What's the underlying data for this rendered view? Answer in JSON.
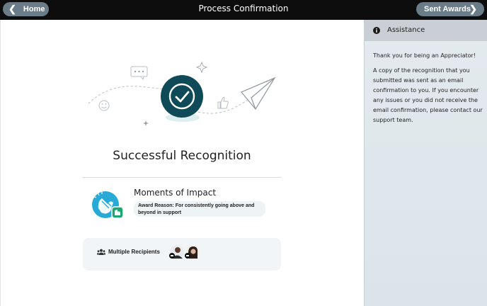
{
  "header": {
    "title": "Process Confirmation",
    "home_label": "Home",
    "sent_label": "Sent Awards"
  },
  "main": {
    "success_title": "Successful Recognition",
    "award": {
      "title": "Moments of Impact",
      "reason_line1": "Award Reason: For consistently going above and",
      "reason_line2": "beyond in support"
    },
    "recipients": {
      "label": "Multiple Recipients"
    }
  },
  "sidebar": {
    "title": "Assistance",
    "paragraph1": "Thank you for being an Appreciator!",
    "paragraph2_lines": [
      "A copy of the recognition that you",
      "submitted was sent as an email",
      "confirmation to you. If you encounter",
      "any issues or you did not receive the",
      "email confirmation, please contact our",
      "support team."
    ]
  },
  "colors": {
    "topbar": "#0d0d0d",
    "nav_button": "#6b7c89",
    "check_circle": "#0e4a57",
    "award_icon": "#29a9d6"
  },
  "icons": [
    "chevron-left-icon",
    "chevron-right-icon",
    "checkmark-icon",
    "paper-plane-icon",
    "chat-bubble-icon",
    "thumbs-up-icon",
    "smiley-icon",
    "clapping-hands-icon",
    "group-icon",
    "info-icon"
  ]
}
